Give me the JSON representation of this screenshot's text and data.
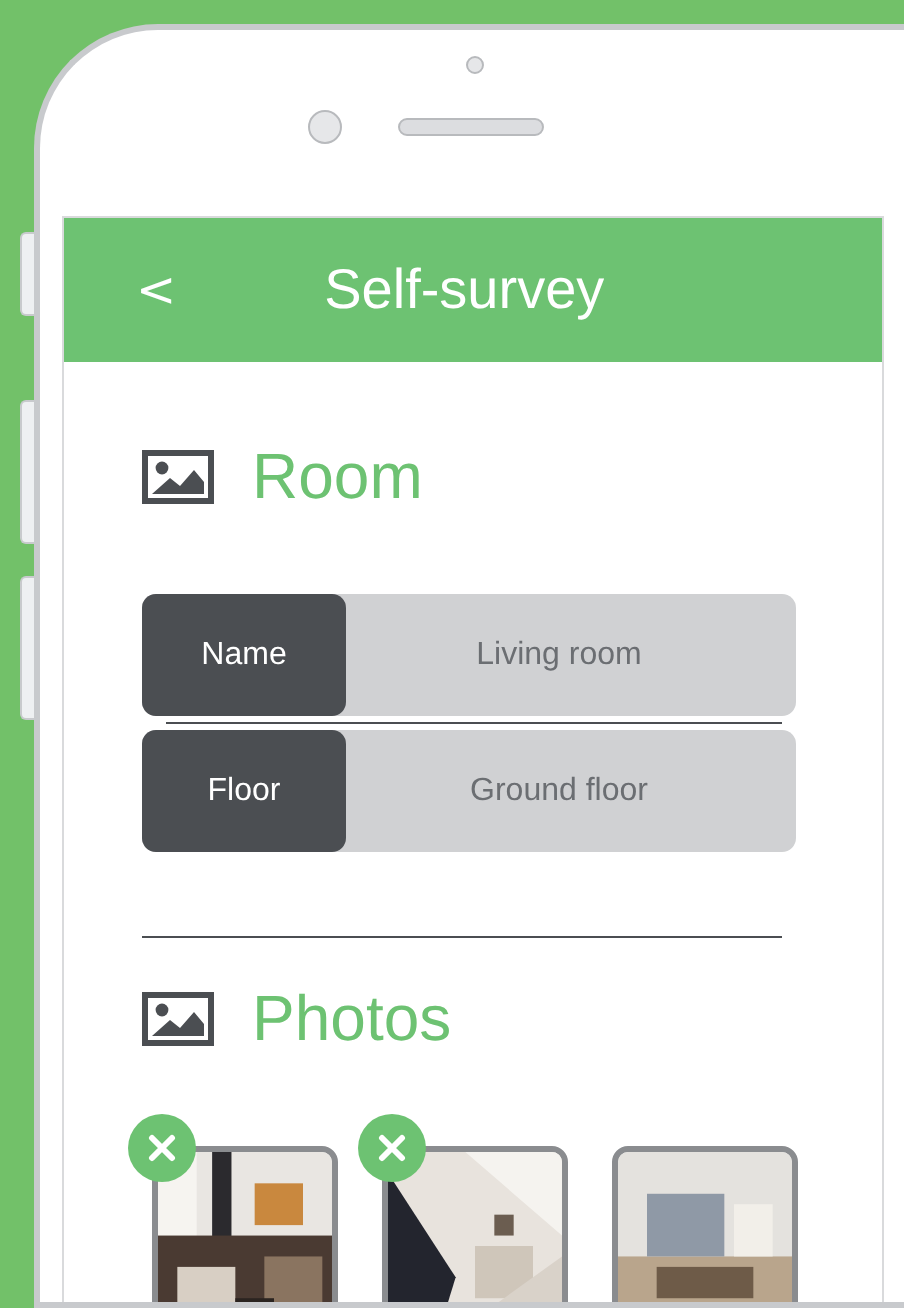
{
  "header": {
    "back": "<",
    "title": "Self-survey"
  },
  "sections": [
    {
      "title": "Room",
      "kind": "fields",
      "fields": [
        {
          "label": "Name",
          "value": "Living room"
        },
        {
          "label": "Floor",
          "value": "Ground floor"
        }
      ]
    },
    {
      "title": "Photos",
      "kind": "photos",
      "photos": [
        {
          "removable": true
        },
        {
          "removable": true
        },
        {
          "removable": false
        }
      ]
    }
  ]
}
